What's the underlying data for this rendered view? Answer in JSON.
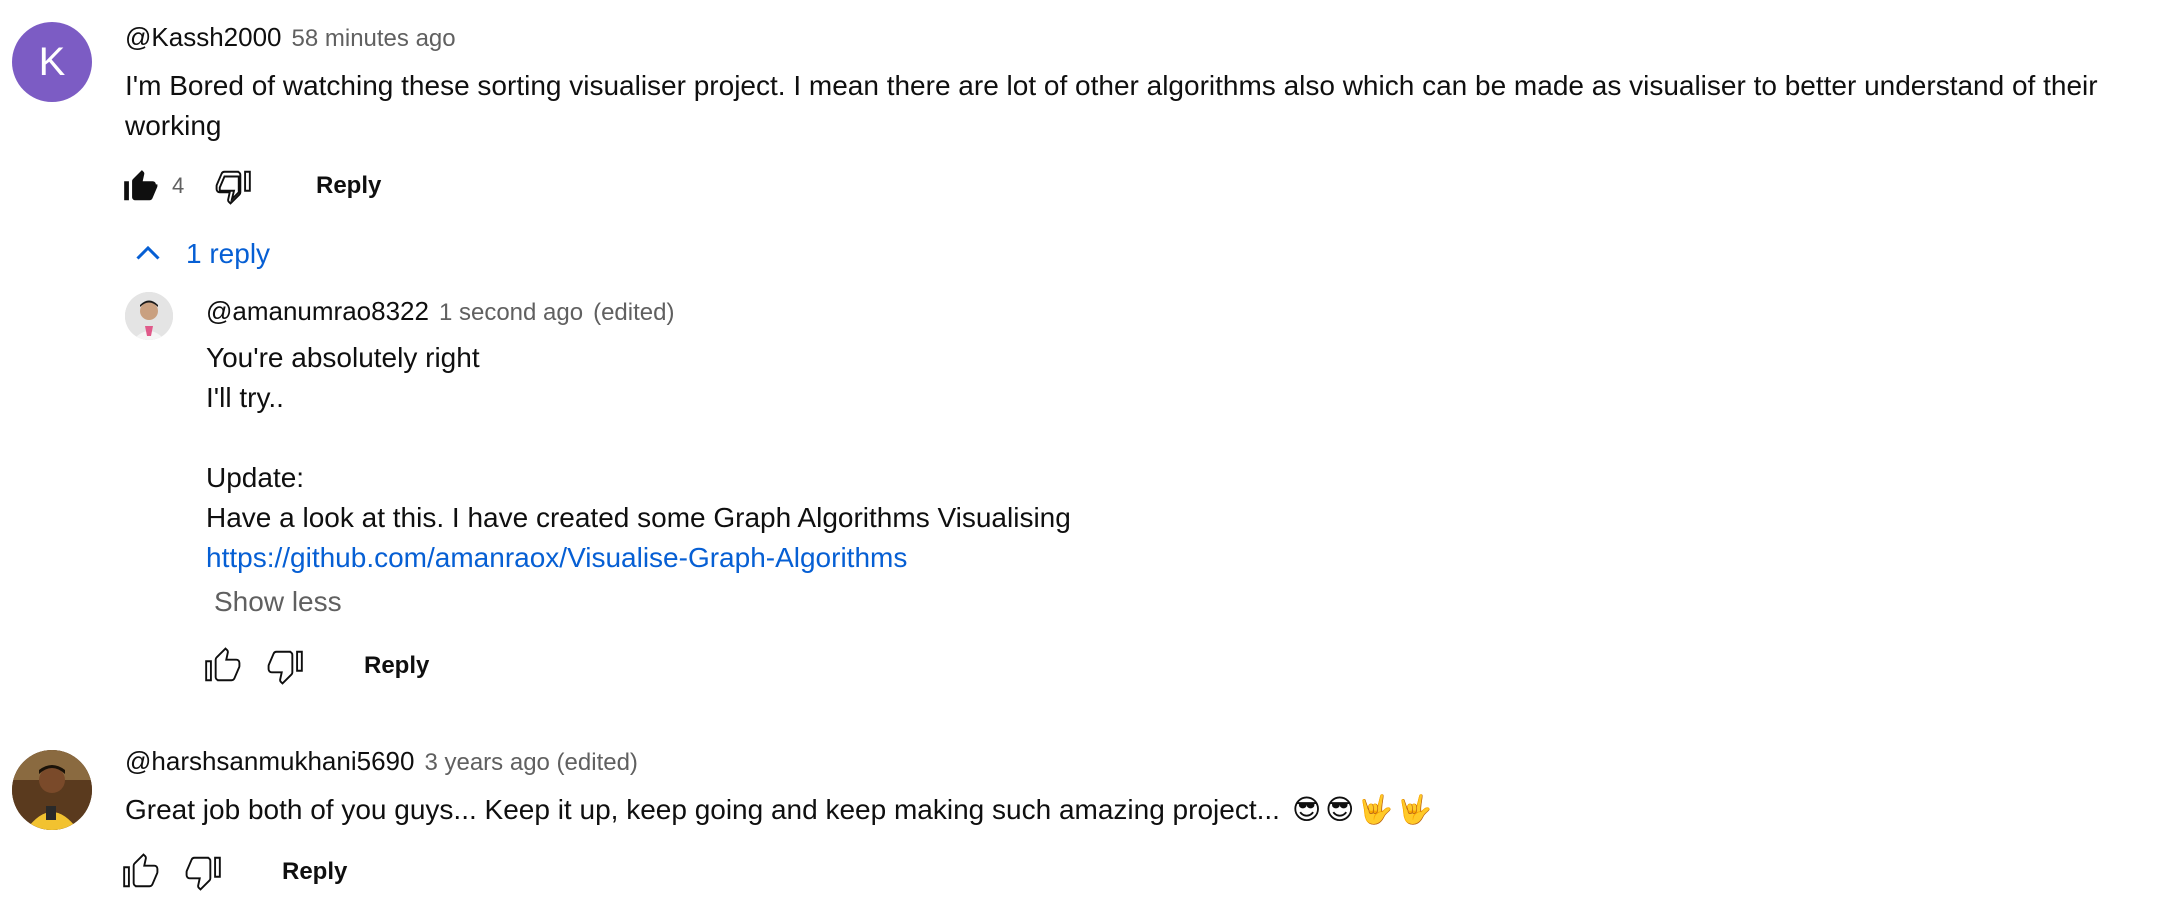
{
  "comments": [
    {
      "avatar_letter": "K",
      "avatar_color": "#7c5cc4",
      "handle": "@Kassh2000",
      "time": "58 minutes ago",
      "text_line1": "I'm Bored of watching these sorting visualiser project. I mean there are lot of other algorithms also which can be made as visualiser to better understand of their",
      "text_line2": "working",
      "likes": "4",
      "reply_label": "Reply",
      "replies_toggle": "1 reply",
      "replies": [
        {
          "handle": "@amanumrao8322",
          "time": "1 second ago",
          "edited": "(edited)",
          "lines": [
            "You're absolutely right",
            "I'll try..",
            "",
            "Update:",
            "Have a look at this. I have created some Graph Algorithms Visualising"
          ],
          "link": "https://github.com/amanraox/Visualise-Graph-Algorithms",
          "show_less": "Show less",
          "reply_label": "Reply"
        }
      ]
    },
    {
      "handle": "@harshsanmukhani5690",
      "time": "3 years ago (edited)",
      "text": "Great job both of you guys... Keep it up, keep going and keep making such amazing project...",
      "emojis": [
        "😎",
        "😎",
        "🤟",
        "🤟"
      ],
      "reply_label": "Reply"
    }
  ],
  "colors": {
    "link": "#065fd4",
    "meta": "#606060",
    "text": "#0f0f0f"
  }
}
